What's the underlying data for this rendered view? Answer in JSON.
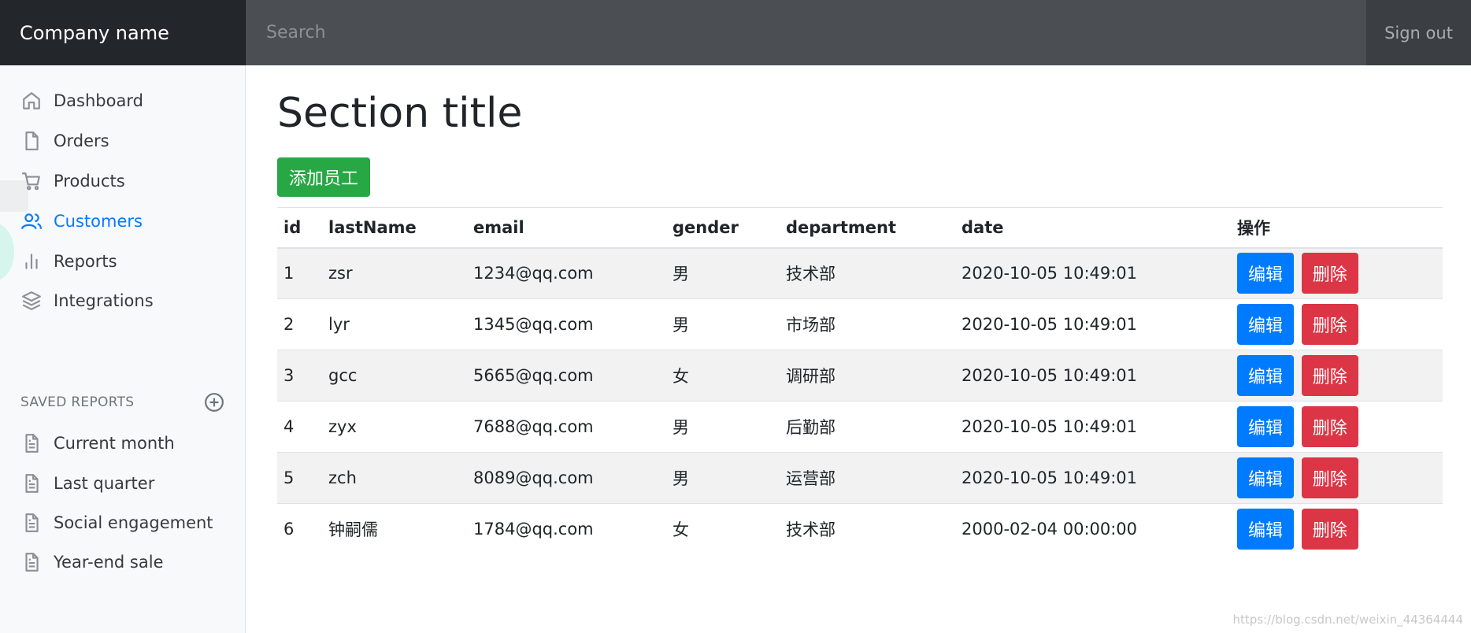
{
  "topbar": {
    "brand": "Company name",
    "search_placeholder": "Search",
    "signout": "Sign out"
  },
  "sidebar": {
    "items": [
      {
        "label": "Dashboard",
        "icon": "home-icon",
        "active": false
      },
      {
        "label": "Orders",
        "icon": "file-icon",
        "active": false
      },
      {
        "label": "Products",
        "icon": "cart-icon",
        "active": false
      },
      {
        "label": "Customers",
        "icon": "users-icon",
        "active": true
      },
      {
        "label": "Reports",
        "icon": "bar-chart-icon",
        "active": false
      },
      {
        "label": "Integrations",
        "icon": "layers-icon",
        "active": false
      }
    ],
    "saved_heading": "SAVED REPORTS",
    "saved_items": [
      {
        "label": "Current month",
        "icon": "file-text-icon"
      },
      {
        "label": "Last quarter",
        "icon": "file-text-icon"
      },
      {
        "label": "Social engagement",
        "icon": "file-text-icon"
      },
      {
        "label": "Year-end sale",
        "icon": "file-text-icon"
      }
    ]
  },
  "main": {
    "title": "Section title",
    "add_button": "添加员工",
    "table": {
      "headers": [
        "id",
        "lastName",
        "email",
        "gender",
        "department",
        "date",
        "操作"
      ],
      "edit_label": "编辑",
      "delete_label": "删除",
      "rows": [
        [
          "1",
          "zsr",
          "1234@qq.com",
          "男",
          "技术部",
          "2020-10-05 10:49:01"
        ],
        [
          "2",
          "lyr",
          "1345@qq.com",
          "男",
          "市场部",
          "2020-10-05 10:49:01"
        ],
        [
          "3",
          "gcc",
          "5665@qq.com",
          "女",
          "调研部",
          "2020-10-05 10:49:01"
        ],
        [
          "4",
          "zyx",
          "7688@qq.com",
          "男",
          "后勤部",
          "2020-10-05 10:49:01"
        ],
        [
          "5",
          "zch",
          "8089@qq.com",
          "男",
          "运营部",
          "2020-10-05 10:49:01"
        ],
        [
          "6",
          "钟嗣儒",
          "1784@qq.com",
          "女",
          "技术部",
          "2000-02-04 00:00:00"
        ]
      ]
    }
  },
  "watermark": "https://blog.csdn.net/weixin_44364444",
  "colors": {
    "accent": "#007bff",
    "success": "#28a745",
    "danger": "#dc3545",
    "topbar": "#343a40"
  }
}
